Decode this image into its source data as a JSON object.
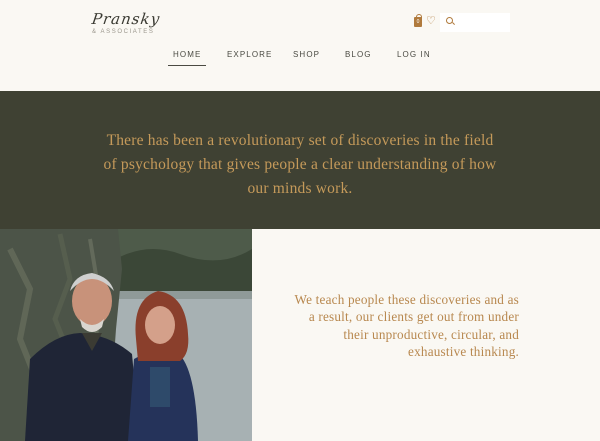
{
  "brand": {
    "logo_script": "Pransky",
    "logo_sub": "& ASSOCIATES"
  },
  "header": {
    "cart_count": "0",
    "search_placeholder": ""
  },
  "nav": {
    "items": [
      {
        "label": "HOME"
      },
      {
        "label": "EXPLORE"
      },
      {
        "label": "SHOP"
      },
      {
        "label": "BLOG"
      },
      {
        "label": "LOG IN"
      }
    ]
  },
  "hero": {
    "text": "There has been a revolutionary set of discoveries in the field of psychology that gives people a clear understanding of how our minds work."
  },
  "intro": {
    "text": "We teach people these discoveries and as a result, our clients get out from under their unproductive, circular, and exhaustive thinking."
  },
  "colors": {
    "background": "#faf8f3",
    "hero_bg": "#3f4133",
    "accent": "#c59a5a",
    "nav_text": "#4a4a42"
  }
}
